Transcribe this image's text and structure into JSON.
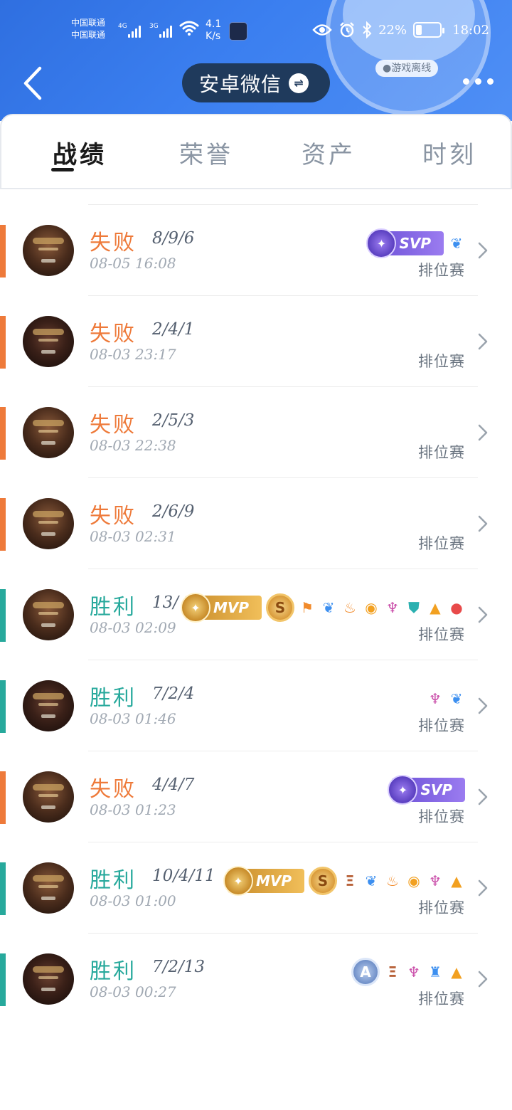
{
  "status_bar": {
    "carrier_1": "中国联通",
    "carrier_2": "中国联通",
    "net_1": "4G",
    "net_2": "3G",
    "speed_value": "4.1",
    "speed_unit": "K/s",
    "battery": "22%",
    "time": "18:02"
  },
  "header": {
    "account_name": "安卓微信",
    "offline_tag": "●游戏离线"
  },
  "tabs": [
    {
      "label": "战绩",
      "active": true
    },
    {
      "label": "荣誉",
      "active": false
    },
    {
      "label": "资产",
      "active": false
    },
    {
      "label": "时刻",
      "active": false
    }
  ],
  "matches": [
    {
      "result": "失败",
      "outcome": "loss",
      "kda": "8/9/6",
      "time": "08-05 16:08",
      "mode": "排位赛",
      "badges": [
        "SVP",
        "blue-wing-icon"
      ]
    },
    {
      "result": "失败",
      "outcome": "loss",
      "kda": "2/4/1",
      "time": "08-03 23:17",
      "mode": "排位赛",
      "badges": []
    },
    {
      "result": "失败",
      "outcome": "loss",
      "kda": "2/5/3",
      "time": "08-03 22:38",
      "mode": "排位赛",
      "badges": []
    },
    {
      "result": "失败",
      "outcome": "loss",
      "kda": "2/6/9",
      "time": "08-03 02:31",
      "mode": "排位赛",
      "badges": []
    },
    {
      "result": "胜利",
      "outcome": "win",
      "kda": "13/",
      "time": "08-03 02:09",
      "mode": "排位赛",
      "badges": [
        "MVP",
        "S",
        "flag-icon",
        "blue-wing-icon",
        "fire-icon",
        "coins-icon",
        "demon-icon",
        "shield-icon",
        "gold-up-icon",
        "blood-drop-icon"
      ]
    },
    {
      "result": "胜利",
      "outcome": "win",
      "kda": "7/2/4",
      "time": "08-03 01:46",
      "mode": "排位赛",
      "badges": [
        "demon-icon",
        "wing-icon"
      ]
    },
    {
      "result": "失败",
      "outcome": "loss",
      "kda": "4/4/7",
      "time": "08-03 01:23",
      "mode": "排位赛",
      "badges": [
        "SVP"
      ]
    },
    {
      "result": "胜利",
      "outcome": "win",
      "kda": "10/4/11",
      "time": "08-03 01:00",
      "mode": "排位赛",
      "badges": [
        "MVP",
        "S",
        "triple-kill-icon",
        "blue-wing-icon",
        "fire-icon",
        "coins-icon",
        "demon-icon",
        "gold-up-icon"
      ]
    },
    {
      "result": "胜利",
      "outcome": "win",
      "kda": "7/2/13",
      "time": "08-03 00:27",
      "mode": "排位赛",
      "badges": [
        "A",
        "triple-kill-icon",
        "demon-icon",
        "tower-icon",
        "gold-up-icon"
      ]
    }
  ],
  "colors": {
    "loss": "#ee7a3a",
    "win": "#27a99c",
    "header_blue": "#3b7ff0",
    "pill_dark": "#1f3a5c"
  }
}
